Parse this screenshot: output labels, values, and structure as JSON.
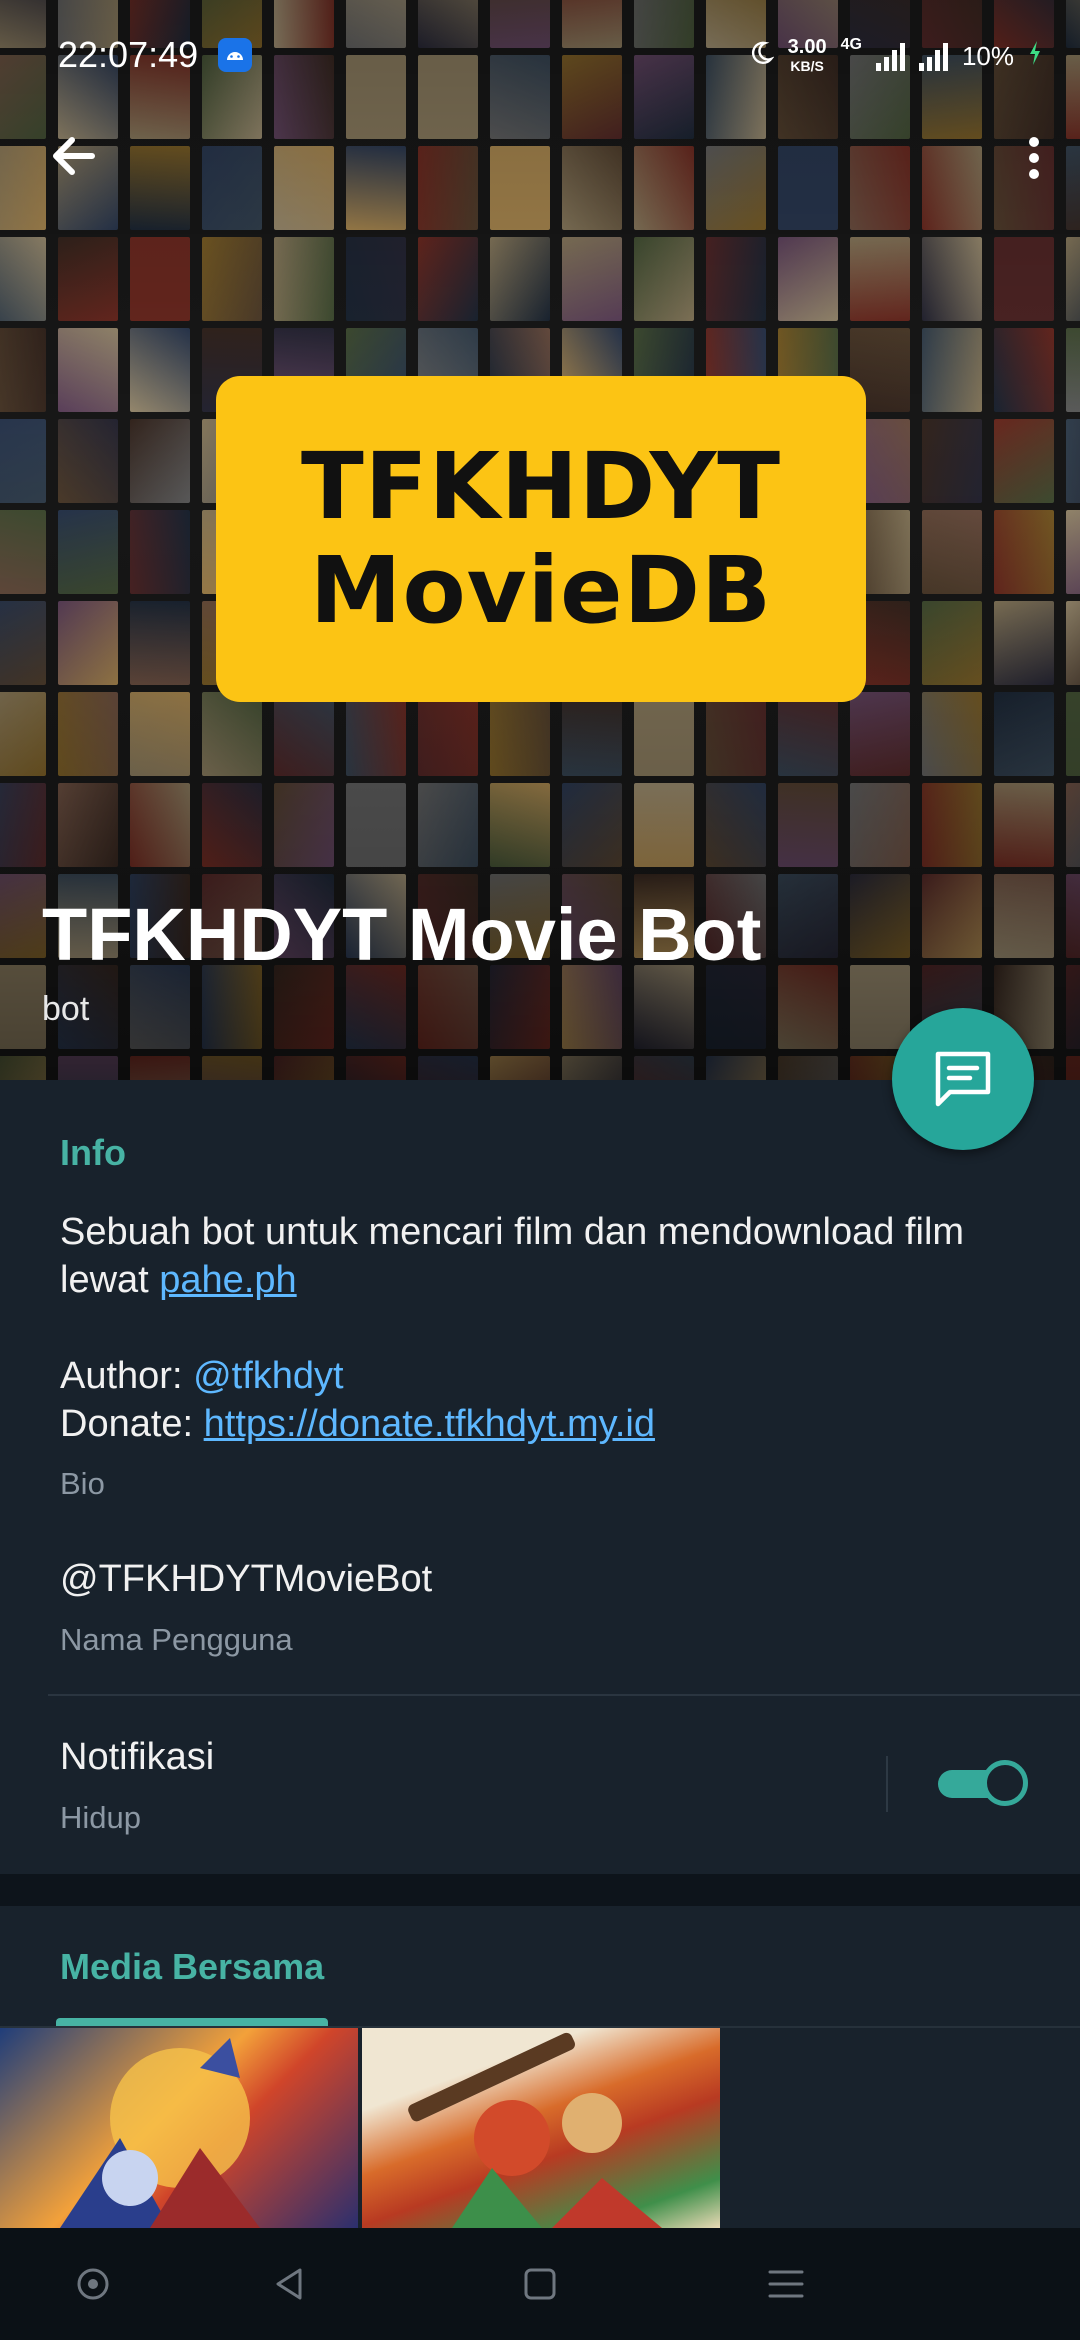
{
  "status_bar": {
    "time": "22:07:49",
    "net_speed_value": "3.00",
    "net_speed_unit": "KB/S",
    "network_type": "4G",
    "battery": "10%"
  },
  "header": {
    "logo_line1": "TFKHDYT",
    "logo_line2": "MovieDB",
    "name": "TFKHDYT Movie Bot",
    "subtitle": "bot"
  },
  "info": {
    "section_title": "Info",
    "bio_text": "Sebuah bot untuk mencari film dan mendownload film lewat ",
    "bio_link": "pahe.ph",
    "author_label": "Author: ",
    "author_handle": "@tfkhdyt",
    "donate_label": "Donate: ",
    "donate_link": "https://donate.tfkhdyt.my.id",
    "bio_caption": "Bio",
    "username": "@TFKHDYTMovieBot",
    "username_caption": "Nama Pengguna",
    "notif_label": "Notifikasi",
    "notif_state": "Hidup",
    "notif_enabled": true
  },
  "media": {
    "section_title": "Media Bersama"
  },
  "colors": {
    "accent": "#47b3a4",
    "fab": "#26a69a",
    "link": "#5eb8ff",
    "logo_bg": "#fcc414",
    "panel": "#18222c"
  },
  "icons": {
    "back": "arrow-left-icon",
    "more": "more-vertical-icon",
    "fab": "message-icon",
    "nav": [
      "home-circle-icon",
      "back-triangle-icon",
      "recents-square-icon",
      "menu-lines-icon"
    ]
  }
}
